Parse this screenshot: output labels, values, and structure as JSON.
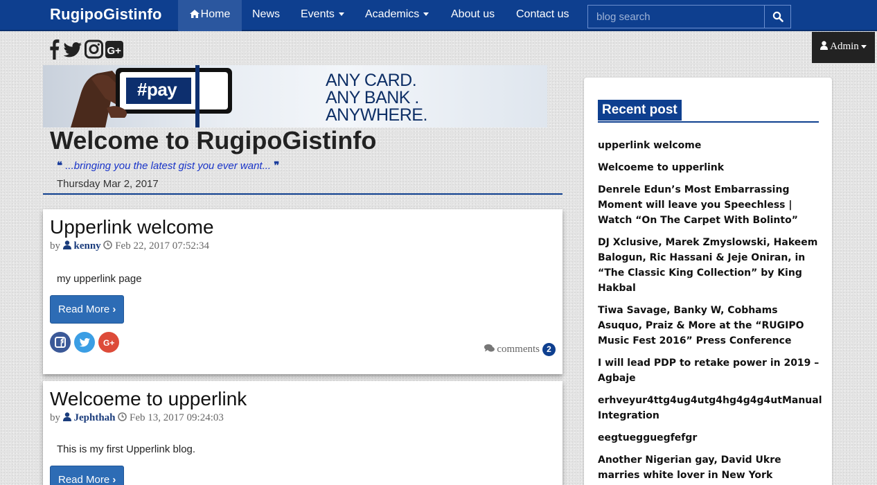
{
  "nav": {
    "brand": "RugipoGistinfo",
    "items": [
      {
        "label": "Home",
        "icon": "home-icon"
      },
      {
        "label": "News"
      },
      {
        "label": "Events",
        "dropdown": true
      },
      {
        "label": "Academics",
        "dropdown": true
      },
      {
        "label": "About us"
      },
      {
        "label": "Contact us"
      }
    ],
    "search_placeholder": "blog search"
  },
  "admin": {
    "label": "Admin"
  },
  "social": [
    "facebook-icon",
    "twitter-icon",
    "instagram-icon",
    "google-plus-icon"
  ],
  "banner": {
    "tag": "#pay",
    "lines": [
      "ANY CARD.",
      "ANY BANK .",
      "ANYWHERE."
    ]
  },
  "header": {
    "title": "Welcome to RugipoGistinfo",
    "tagline": "...bringing you the latest gist you ever want...",
    "date": "Thursday Mar 2, 2017"
  },
  "posts": [
    {
      "title": "Upperlink welcome",
      "by": "by",
      "author": "kenny",
      "timestamp": "Feb 22, 2017 07:52:34",
      "body": "my upperlink page",
      "read_more": "Read More",
      "comments_label": "comments",
      "comments_count": "2"
    },
    {
      "title": "Welcoeme to upperlink",
      "by": "by",
      "author": "Jephthah",
      "timestamp": "Feb 13, 2017 09:24:03",
      "body": "This is my first Upperlink blog.",
      "read_more": "Read More"
    }
  ],
  "sidebar": {
    "heading": "Recent post",
    "items": [
      "upperlink welcome",
      "Welcoeme to upperlink",
      "Denrele Edun’s Most Embarrassing Moment will leave you Speechless | Watch “On The Carpet With Bolinto”",
      "DJ Xclusive, Marek Zmyslowski, Hakeem Balogun, Ric Hassani & Jeje Oniran, in “The Classic King Collection” by King Hakbal",
      "Tiwa Savage, Banky W, Cobhams Asuquo, Praiz & More at the “RUGIPO Music Fest 2016” Press Conference",
      "I will lead PDP to retake power in 2019 – Agbaje",
      "erhveyur4ttg4ug4utg4hg4g4g4utManual Integration",
      "eegtuegguegfefgr",
      "Another Nigerian gay, David Ukre marries white lover in New York"
    ]
  },
  "colors": {
    "navbar": "#0e3f8f",
    "accent": "#2d6cb5",
    "tagline": "#1a35c9"
  }
}
